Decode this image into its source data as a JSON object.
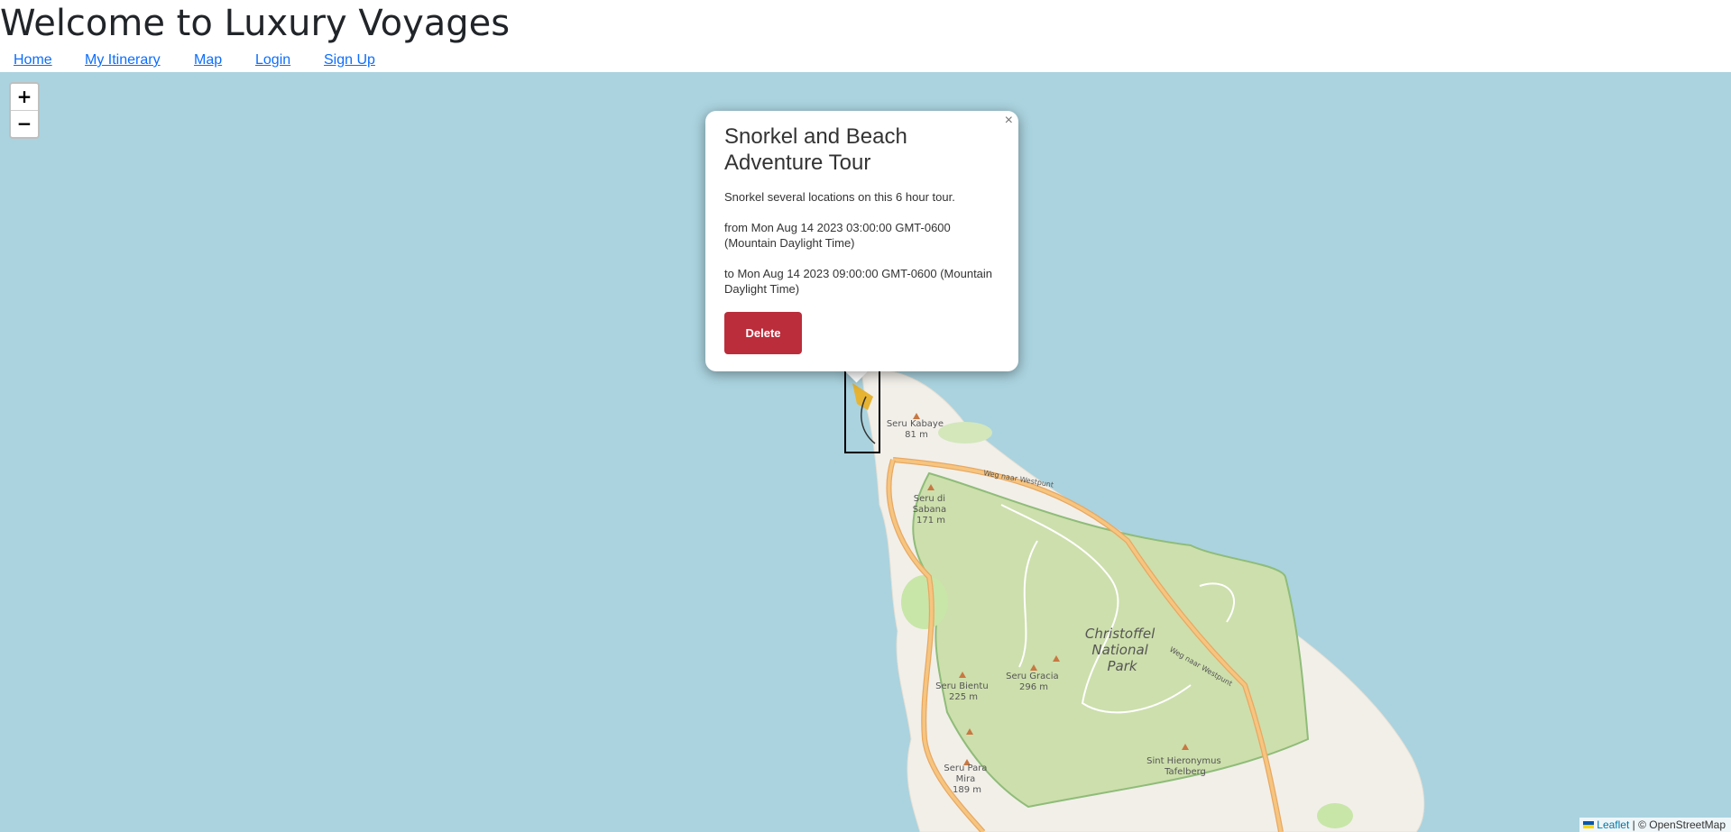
{
  "header": {
    "title": "Welcome to Luxury Voyages"
  },
  "nav": {
    "items": [
      "Home",
      "My Itinerary",
      "Map",
      "Login",
      "Sign Up"
    ]
  },
  "map": {
    "zoom_in": "+",
    "zoom_out": "−",
    "labels": {
      "park": [
        "Christoffel",
        "National",
        "Park"
      ],
      "kabaye": [
        "Seru Kabaye",
        "81 m"
      ],
      "sabana": [
        "Seru di",
        "Sabana",
        "171 m"
      ],
      "gracia": [
        "Seru Gracia",
        "296 m"
      ],
      "bientu": [
        "Seru Bientu",
        "225 m"
      ],
      "paramira": [
        "Seru Para",
        "Mira",
        "189 m"
      ],
      "tafelberg": [
        "Sint Hieronymus",
        "Tafelberg"
      ],
      "road": "Weg naar Westpunt"
    },
    "attribution": {
      "leaflet": "Leaflet",
      "osm": "| © OpenStreetMap"
    }
  },
  "popup": {
    "close": "×",
    "title": "Snorkel and Beach Adventure Tour",
    "description": "Snorkel several locations on this 6 hour tour.",
    "from": "from Mon Aug 14 2023 03:00:00 GMT-0600 (Mountain Daylight Time)",
    "to": "to Mon Aug 14 2023 09:00:00 GMT-0600 (Mountain Daylight Time)",
    "delete_label": "Delete"
  },
  "colors": {
    "water": "#aad3df",
    "land": "#f2efe9",
    "park": "#cddfac",
    "road": "#f6c57f",
    "delete": "#bb2d3b",
    "link": "#0d6efd"
  }
}
